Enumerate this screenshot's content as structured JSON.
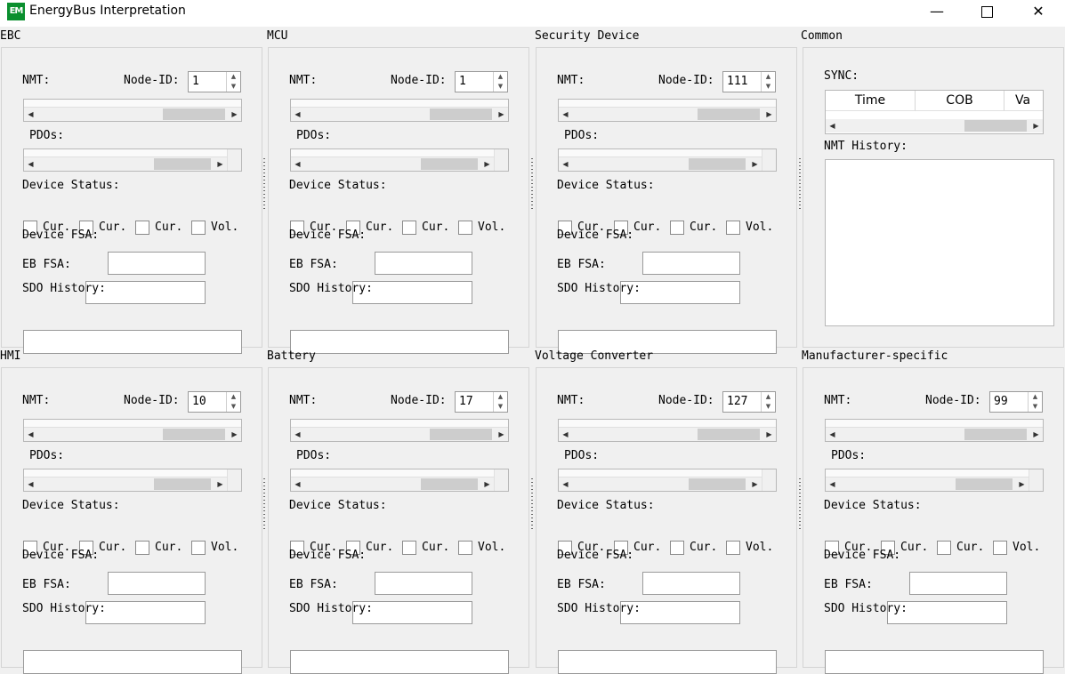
{
  "window": {
    "title": "EnergyBus Interpretation",
    "icon_text": "EM",
    "controls": {
      "minimize": "—",
      "close": "✕"
    }
  },
  "labels": {
    "nmt": "NMT:",
    "node_id": "Node-ID:",
    "pdos": "PDOs:",
    "device_status": "Device Status:",
    "cur": "Cur.",
    "vol": "Vol.",
    "device_fsa": "Device FSA:",
    "eb_fsa": "EB FSA:",
    "sdo_history": "SDO History:"
  },
  "panels": [
    {
      "title": "EBC",
      "node_id": "1"
    },
    {
      "title": "MCU",
      "node_id": "1"
    },
    {
      "title": "Security Device",
      "node_id": "111"
    },
    {
      "title": "HMI",
      "node_id": "10"
    },
    {
      "title": "Battery",
      "node_id": "17"
    },
    {
      "title": "Voltage Converter",
      "node_id": "127"
    },
    {
      "title": "Manufacturer-specific",
      "node_id": "99"
    }
  ],
  "common": {
    "title": "Common",
    "sync_label": "SYNC:",
    "columns": [
      "Time",
      "COB",
      "Va"
    ],
    "nmt_history_label": "NMT History:"
  }
}
